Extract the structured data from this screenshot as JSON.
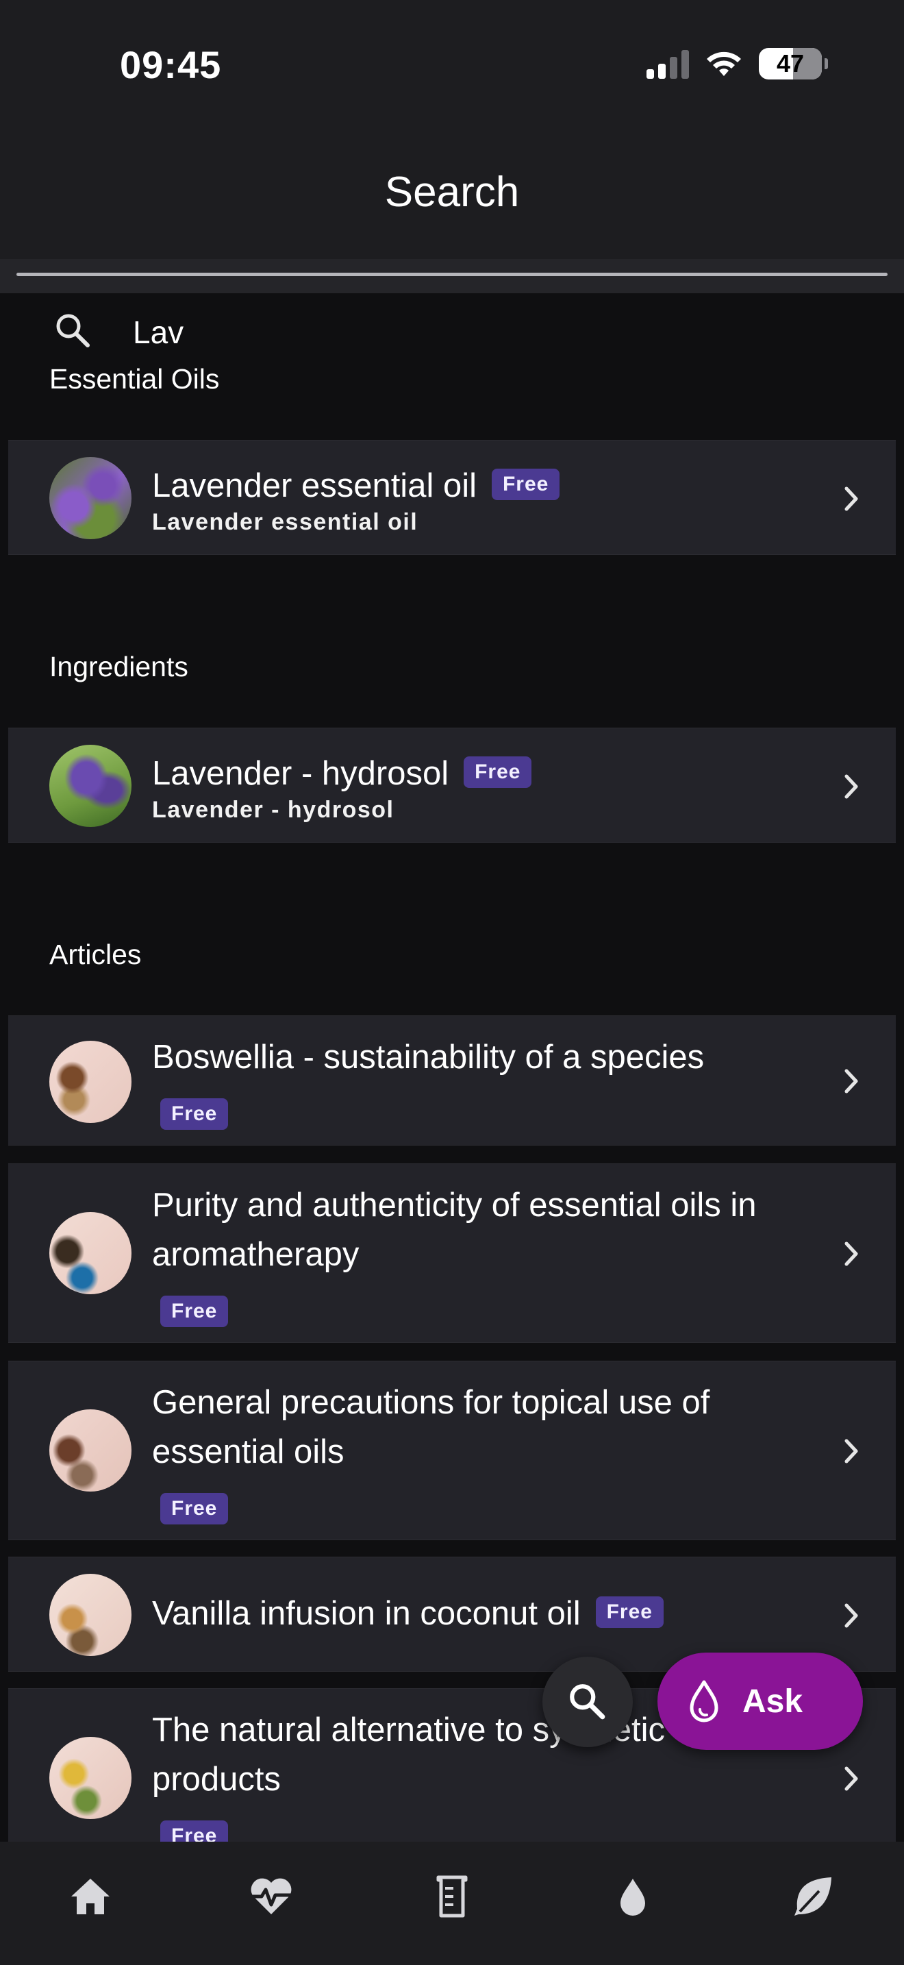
{
  "status_bar": {
    "time": "09:45",
    "battery": "47"
  },
  "header": {
    "title": "Search"
  },
  "search": {
    "query": "Lav"
  },
  "sections": {
    "essential_oils": {
      "title": "Essential Oils",
      "items": [
        {
          "title": "Lavender essential oil",
          "subtitle": "Lavender essential oil",
          "badge": "Free"
        }
      ]
    },
    "ingredients": {
      "title": "Ingredients",
      "items": [
        {
          "title": "Lavender - hydrosol",
          "subtitle": "Lavender - hydrosol",
          "badge": "Free"
        }
      ]
    },
    "articles": {
      "title": "Articles",
      "items": [
        {
          "title": "Boswellia - sustainability of a species",
          "badge": "Free"
        },
        {
          "title": "Purity and authenticity of essential oils in aromatherapy",
          "badge": "Free"
        },
        {
          "title": "General precautions for topical use of essential oils",
          "badge": "Free"
        },
        {
          "title": "Vanilla infusion in coconut oil",
          "badge": "Free"
        },
        {
          "title": "The natural alternative to synthetic cleaning products",
          "badge": "Free"
        }
      ]
    }
  },
  "fab": {
    "ask_label": "Ask"
  },
  "bottom_nav": {
    "items": [
      {
        "icon": "home-icon"
      },
      {
        "icon": "heartbeat-icon"
      },
      {
        "icon": "beaker-icon"
      },
      {
        "icon": "drop-icon"
      },
      {
        "icon": "leaf-icon"
      }
    ]
  },
  "colors": {
    "accent": "#8a1496",
    "badge": "#4b3a92",
    "card": "#232329",
    "background": "#0f0f11"
  }
}
